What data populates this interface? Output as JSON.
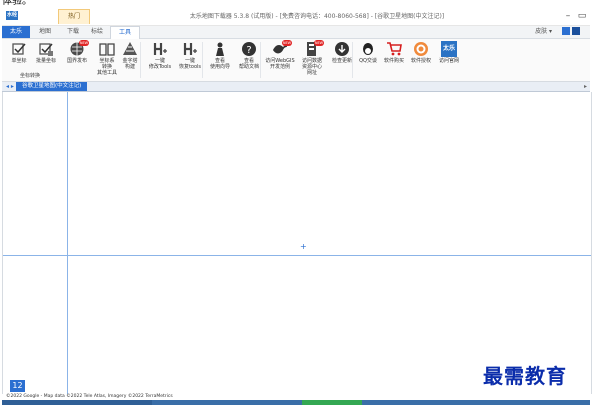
{
  "top_caption": "体验。",
  "titlebar": {
    "logo": "水经",
    "hot_tab": "热门",
    "window_title": "太乐地图下载器 5.3.8 (试用版) - [免费咨询电话：400-8060-568] - [谷歌卫星地图(中文注记)]",
    "minimize": "–",
    "maximize": "▭"
  },
  "tabs": [
    {
      "label": "太乐"
    },
    {
      "label": "地图"
    },
    {
      "label": "下载"
    },
    {
      "label": "标绘"
    },
    {
      "label": "工具"
    }
  ],
  "right_controls": {
    "skin": "皮肤 ▾"
  },
  "ribbon": {
    "buttons": [
      {
        "label": "单坐标",
        "icon": "checkbox-icon",
        "hot": false
      },
      {
        "label": "批量坐标",
        "icon": "checkbox-list-icon",
        "hot": false
      },
      {
        "label": "国界发布",
        "icon": "globe-icon",
        "hot": true,
        "badge": "NEW"
      },
      {
        "label": "坐标系\n转换\n其他工具",
        "icon": "book-icon",
        "hot": false
      },
      {
        "label": "金字塔\n构建",
        "icon": "pyramid-icon",
        "hot": false
      },
      {
        "label": "一键\n修改Tools",
        "icon": "h-tool-icon",
        "hot": false
      },
      {
        "label": "一键\n恢复tools",
        "icon": "h-tool-icon",
        "hot": false
      },
      {
        "label": "查看\n使用向导",
        "icon": "person-icon",
        "hot": false
      },
      {
        "label": "查看\n帮助文档",
        "icon": "help-icon",
        "hot": false
      },
      {
        "label": "访问WebGIS\n开发范例",
        "icon": "pigeon-icon",
        "hot": true,
        "badge": "NEW"
      },
      {
        "label": "访问数据\n资源中心\n网址",
        "icon": "data-center-icon",
        "hot": true,
        "badge": "NEW"
      },
      {
        "label": "检查更新",
        "icon": "download-icon",
        "hot": false
      },
      {
        "label": "QQ交谈",
        "icon": "qq-icon",
        "hot": false
      },
      {
        "label": "软件购买",
        "icon": "cart-icon",
        "hot": false
      },
      {
        "label": "软件授权",
        "icon": "target-icon",
        "hot": false
      },
      {
        "label": "访问官网",
        "icon": "brand-icon",
        "hot": false,
        "brand": "太乐"
      }
    ],
    "group_label": "坐标转换"
  },
  "doc_tab": {
    "label": "谷歌卫星地图(中文注记)",
    "nav": "◂ ▸",
    "menu": "▸"
  },
  "map": {
    "zoom_level": "12",
    "crosshair": "+"
  },
  "copyright": "©2022 Google - Map data ©2022 Tele Atlas, Imagery ©2022 TerraMetrics",
  "watermark": "最需教育",
  "colors": {
    "accent": "#2b6fd1",
    "hot_badge": "#e02424",
    "watermark": "#0b2dab"
  }
}
